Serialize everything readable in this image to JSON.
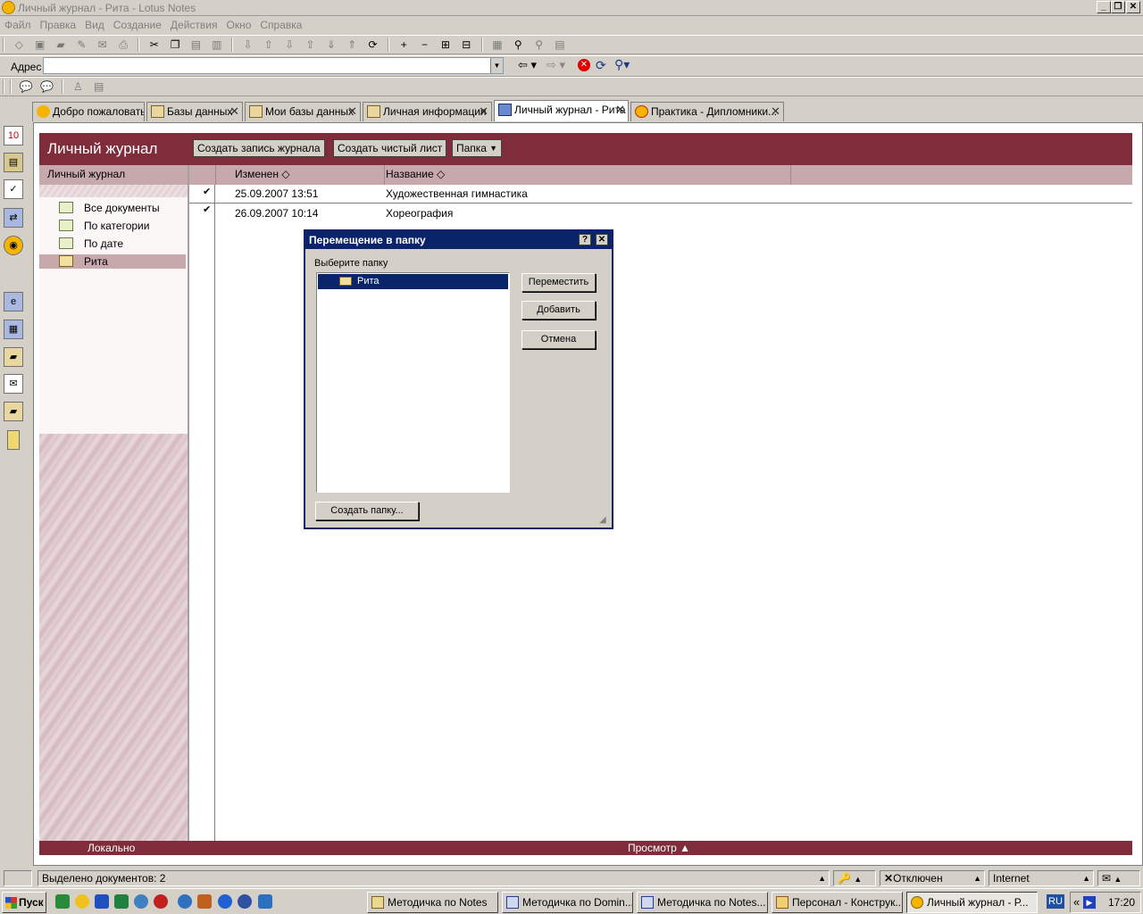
{
  "window": {
    "title": "Личный журнал - Рита - Lotus Notes"
  },
  "menu": [
    "Файл",
    "Правка",
    "Вид",
    "Создание",
    "Действия",
    "Окно",
    "Справка"
  ],
  "address": {
    "label": "Адрес",
    "value": ""
  },
  "tabs": [
    {
      "label": "Добро пожаловать",
      "icon": "lotus-icon",
      "closable": false
    },
    {
      "label": "Базы данных",
      "icon": "database-icon",
      "closable": true
    },
    {
      "label": "Мои базы данных",
      "icon": "database-icon",
      "closable": true
    },
    {
      "label": "Личная информация",
      "icon": "database-icon",
      "closable": true
    },
    {
      "label": "Личный журнал - Рита",
      "icon": "journal-icon",
      "closable": true,
      "active": true
    },
    {
      "label": "Практика - Дипломники...",
      "icon": "lotus-icon",
      "closable": true
    }
  ],
  "view": {
    "title": "Личный журнал",
    "buttons": {
      "new_entry": "Создать запись журнала",
      "new_blank": "Создать чистый лист",
      "folder": "Папка"
    },
    "nav_header": "Личный журнал",
    "nav_items": [
      "Все документы",
      "По категории",
      "По дате",
      "Рита"
    ],
    "columns": {
      "modified": "Изменен",
      "name": "Название"
    },
    "rows": [
      {
        "checked": "✔",
        "modified": "25.09.2007 13:51",
        "name": "Художественная гимнастика"
      },
      {
        "checked": "✔",
        "modified": "26.09.2007 10:14",
        "name": "Хореография"
      }
    ],
    "footer": {
      "left": "Локально",
      "right": "Просмотр"
    }
  },
  "dialog": {
    "title": "Перемещение в папку",
    "help": "?",
    "close": "✕",
    "prompt": "Выберите папку",
    "folders": [
      "Рита"
    ],
    "buttons": {
      "move": "Переместить",
      "add": "Добавить",
      "cancel": "Отмена",
      "create": "Создать папку..."
    }
  },
  "status": {
    "selected": "Выделено документов: 2",
    "connection": "Отключен",
    "location": "Internet"
  },
  "taskbar": {
    "start": "Пуск",
    "tasks": [
      "Методичка по Notes",
      "Методичка по Domin...",
      "Методичка по Notes...",
      "Персонал - Конструк...",
      "Личный журнал - Р..."
    ],
    "lang": "RU",
    "chevron": "«",
    "time": "17:20"
  },
  "colors": {
    "accent": "#7f2d3b",
    "accent_light": "#c7a8ad",
    "dialog_title": "#0a246a"
  }
}
